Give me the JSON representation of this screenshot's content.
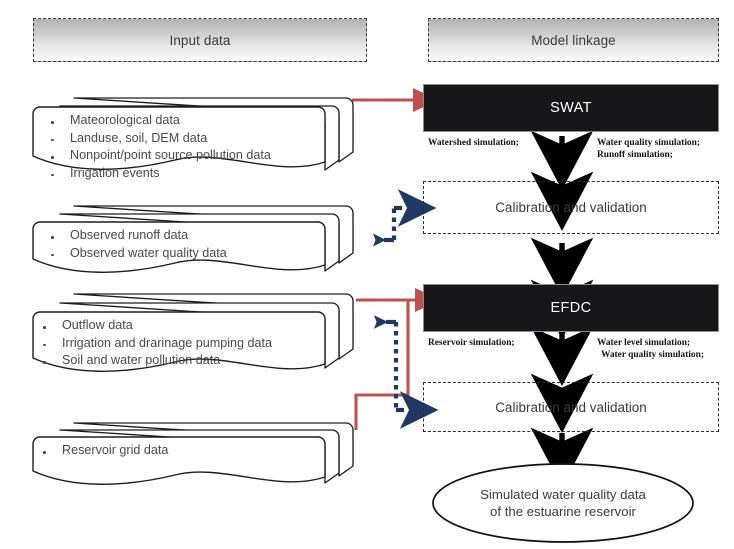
{
  "headers": {
    "input": "Input data",
    "linkage": "Model linkage"
  },
  "models": {
    "swat": "SWAT",
    "efdc": "EFDC"
  },
  "calibration": {
    "upper": "Calibration and validation",
    "lower": "Calibration and validation"
  },
  "annotations": {
    "swat_left": "Watershed simulation;",
    "swat_right_line1": "Water quality simulation;",
    "swat_right_line2": "Runoff simulation;",
    "efdc_left": "Reservoir simulation;",
    "efdc_right_line1": "Water level simulation;",
    "efdc_right_line2": "Water quality simulation;"
  },
  "result": {
    "line1": "Simulated water quality data",
    "line2": "of the estuarine reservoir"
  },
  "stacks": [
    {
      "id": "swat-inputs",
      "items": [
        "Mateorological data",
        "Landuse, soil, DEM data",
        "Nonpoint/point source pollution data",
        "Irrigation events"
      ]
    },
    {
      "id": "observed-data",
      "items": [
        "Observed runoff data",
        "Observed water quality data"
      ]
    },
    {
      "id": "efdc-inputs",
      "items": [
        "Outflow data",
        "Irrigation and drarinage pumping data",
        "Soil and water pollution data"
      ]
    },
    {
      "id": "grid-data",
      "items": [
        "Reservoir grid data"
      ]
    }
  ],
  "colors": {
    "red_connector": "#c0504d",
    "blue_connector": "#1f3864",
    "black_arrow": "#000000",
    "model_box": "#17171a",
    "banner_top": "#b3b3b3",
    "banner_bottom": "#fbfbfb"
  }
}
